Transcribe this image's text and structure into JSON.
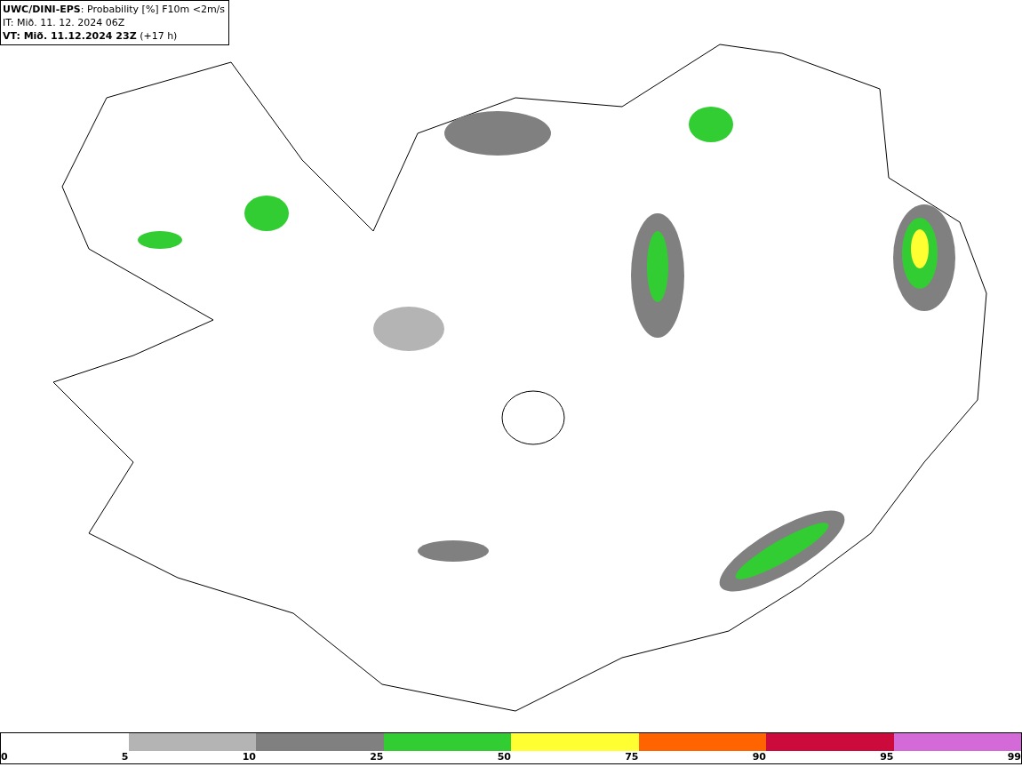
{
  "header": {
    "lines": [
      "**UWC/DINI-EPS**: Probability [%] F10m <2m/s",
      "IT: Mið. 11. 12. 2024 06Z",
      "**VT: Mið. 11.12.2024 23Z** (+17 h)"
    ]
  },
  "legend": {
    "segments": [
      {
        "color": "#b4b4b4"
      },
      {
        "color": "#808080"
      },
      {
        "color": "#32cd32"
      },
      {
        "color": "#ffff32"
      },
      {
        "color": "#ff6400"
      },
      {
        "color": "#cd0a3c"
      },
      {
        "color": "#d46ad8"
      }
    ],
    "labels": [
      "0",
      "5",
      "10",
      "25",
      "50",
      "75",
      "90",
      "95",
      "99"
    ]
  }
}
